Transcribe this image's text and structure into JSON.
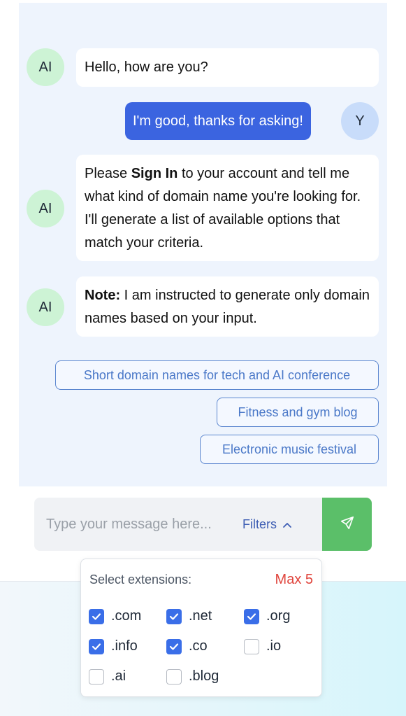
{
  "messages": [
    {
      "sender": "ai",
      "avatar": "AI",
      "text": "Hello, how are you?"
    },
    {
      "sender": "user",
      "avatar": "Y",
      "text": "I'm good, thanks for asking!"
    },
    {
      "sender": "ai",
      "avatar": "AI",
      "pre": "Please ",
      "bold": "Sign In",
      "post": " to your account and tell me what kind of domain name you're looking for. I'll generate a list of available options that match your criteria."
    },
    {
      "sender": "ai",
      "avatar": "AI",
      "bold": "Note:",
      "post": " I am instructed to generate only domain names based on your input."
    }
  ],
  "suggestions": [
    "Short domain names for tech and AI conference",
    "Fitness and gym blog",
    "Electronic music festival"
  ],
  "input": {
    "placeholder": "Type your message here...",
    "filters_label": "Filters",
    "filters_icon": "chevron-up-icon",
    "send_icon": "send-icon"
  },
  "filters": {
    "title": "Select extensions:",
    "max_label": "Max 5",
    "extensions": [
      {
        "label": ".com",
        "checked": true
      },
      {
        "label": ".net",
        "checked": true
      },
      {
        "label": ".org",
        "checked": true
      },
      {
        "label": ".info",
        "checked": true
      },
      {
        "label": ".co",
        "checked": true
      },
      {
        "label": ".io",
        "checked": false
      },
      {
        "label": ".ai",
        "checked": false
      },
      {
        "label": ".blog",
        "checked": false
      }
    ]
  },
  "colors": {
    "user_bubble": "#3b64e0",
    "ai_avatar": "#cdf3d5",
    "user_avatar": "#c8dcfa",
    "send_button": "#5bbf69",
    "checkbox_checked": "#3a6ee8",
    "max_label": "#e0453d"
  }
}
